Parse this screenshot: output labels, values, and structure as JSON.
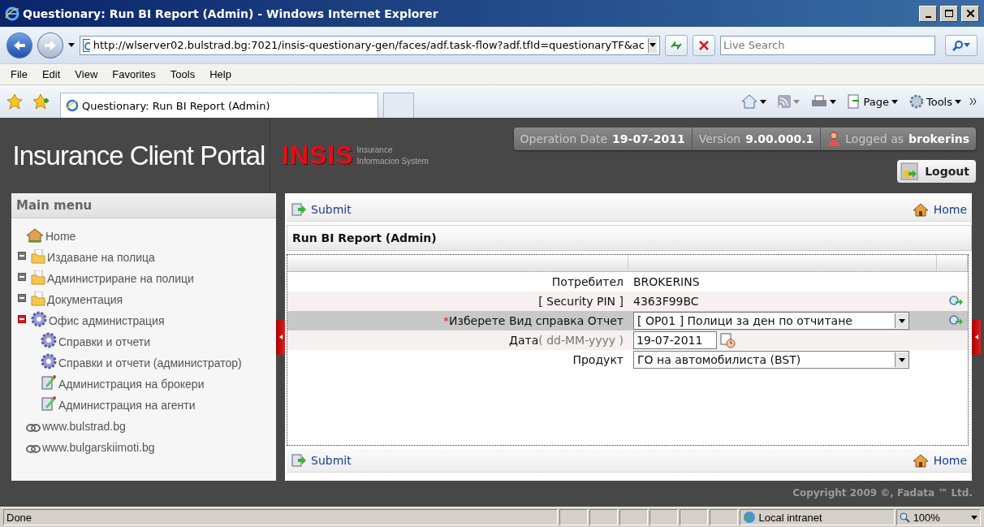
{
  "browser": {
    "title": "Questionary: Run BI Report (Admin) - Windows Internet Explorer",
    "address": "http://wlserver02.bulstrad.bg:7021/insis-questionary-gen/faces/adf.task-flow?adf.tfId=questionaryTF&ac",
    "search_placeholder": "Live Search",
    "menu": [
      "File",
      "Edit",
      "View",
      "Favorites",
      "Tools",
      "Help"
    ],
    "tabs": [
      {
        "title": "Questionary: Run BI Report (Admin)",
        "selected": true
      }
    ],
    "command_bar": [
      {
        "kind": "home"
      },
      {
        "kind": "feeds"
      },
      {
        "kind": "print"
      },
      {
        "kind": "page",
        "label": "Page"
      },
      {
        "kind": "tools",
        "label": "Tools"
      }
    ],
    "status": "Done",
    "zone": "Local intranet",
    "zoom": "100%"
  },
  "header": {
    "portal_title": "Insurance Client Portal",
    "logo": "INSIS",
    "logo_caption": [
      "Insurance",
      "Informacion System"
    ],
    "info": [
      {
        "kind": "plain",
        "label": "Operation Date",
        "value": "19-07-2011"
      },
      {
        "kind": "plain",
        "label": "Version",
        "value": "9.00.000.1"
      },
      {
        "kind": "user",
        "label": "Logged as",
        "value": "brokerins"
      }
    ],
    "logout": "Logout"
  },
  "main_menu": {
    "title": "Main menu",
    "items": [
      {
        "kind": "home",
        "label": "Home"
      },
      {
        "kind": "folder",
        "label": "Издаване на полица",
        "expanded": false
      },
      {
        "kind": "folder",
        "label": "Администриране на полици",
        "expanded": false
      },
      {
        "kind": "folder",
        "label": "Документация",
        "expanded": false
      },
      {
        "kind": "gear",
        "label": "Офис администрация",
        "expanded": true,
        "children": [
          {
            "kind": "gear",
            "label": "Справки и отчети"
          },
          {
            "kind": "gear",
            "label": "Справки и отчети (администратор)"
          },
          {
            "kind": "edit",
            "label": "Администрация на брокери"
          },
          {
            "kind": "edit",
            "label": "Администрация на агенти"
          }
        ]
      },
      {
        "kind": "link",
        "label": "www.bulstrad.bg"
      },
      {
        "kind": "link",
        "label": "www.bulgarskiimoti.bg"
      }
    ]
  },
  "page": {
    "top_actions": {
      "submit": "Submit",
      "home": "Home"
    },
    "title": "Run BI Report (Admin)",
    "required_mark": "*",
    "rows": [
      {
        "kind": "text",
        "label": "Потребител",
        "value": "BROKERINS",
        "required": false,
        "highlighted": false,
        "lookup": false
      },
      {
        "kind": "text",
        "label": "[ Security PIN ]",
        "value": "4363F99BC",
        "required": false,
        "highlighted": false,
        "lookup": true
      },
      {
        "kind": "select",
        "label": "Изберете Вид справка Отчет",
        "value": "[ OP01 ] Полици за ден по отчитане",
        "required": true,
        "highlighted": true,
        "lookup": true
      },
      {
        "kind": "date",
        "label": "Дата",
        "hint": "( dd-MM-yyyy )",
        "value": "19-07-2011",
        "required": false,
        "highlighted": false,
        "lookup": false
      },
      {
        "kind": "select",
        "label": "Продукт",
        "value": "ГО на автомобилиста (BST)",
        "required": false,
        "highlighted": false,
        "lookup": false
      }
    ],
    "bottom_actions": {
      "submit": "Submit",
      "home": "Home"
    }
  },
  "copyright": "Copyright 2009 ©, Fadata ™ Ltd."
}
